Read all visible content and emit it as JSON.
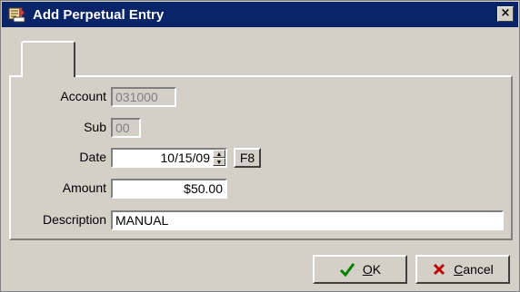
{
  "window": {
    "title": "Add Perpetual Entry",
    "close_label": "×"
  },
  "form": {
    "account": {
      "label": "Account",
      "value": "031000"
    },
    "sub": {
      "label": "Sub",
      "value": "00"
    },
    "date": {
      "label": "Date",
      "value": "10/15/09",
      "f8_label": "F8"
    },
    "amount": {
      "label": "Amount",
      "value": "$50.00"
    },
    "description": {
      "label": "Description",
      "value": "MANUAL"
    }
  },
  "buttons": {
    "ok": {
      "mnemonic": "O",
      "rest": "K"
    },
    "cancel": {
      "mnemonic": "C",
      "rest": "ancel"
    }
  },
  "colors": {
    "titlebar": "#0a246a",
    "ok_check": "#008000",
    "cancel_x": "#c00000"
  }
}
